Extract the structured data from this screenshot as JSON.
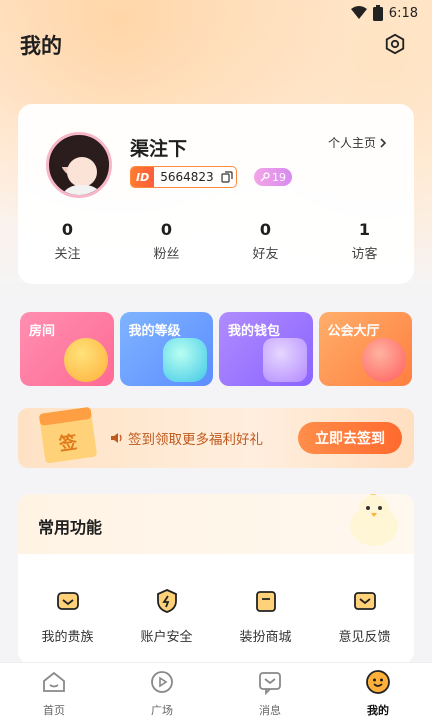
{
  "status_bar": {
    "time": "6:18"
  },
  "header": {
    "title": "我的"
  },
  "profile": {
    "username": "渠注下",
    "homepage_link": "个人主页",
    "id_tag": "ID",
    "id_value": "5664823",
    "level": "19",
    "stats": [
      {
        "value": "0",
        "label": "关注"
      },
      {
        "value": "0",
        "label": "粉丝"
      },
      {
        "value": "0",
        "label": "好友"
      },
      {
        "value": "1",
        "label": "访客"
      }
    ]
  },
  "features": [
    {
      "label": "房间"
    },
    {
      "label": "我的等级"
    },
    {
      "label": "我的钱包"
    },
    {
      "label": "公会大厅"
    }
  ],
  "signin": {
    "calendar_char": "签",
    "text": "签到领取更多福利好礼",
    "button": "立即去签到"
  },
  "tools": {
    "title": "常用功能",
    "items": [
      {
        "label": "我的贵族",
        "icon": "noble-icon"
      },
      {
        "label": "账户安全",
        "icon": "security-icon"
      },
      {
        "label": "装扮商城",
        "icon": "store-icon"
      },
      {
        "label": "意见反馈",
        "icon": "feedback-icon"
      }
    ]
  },
  "tabbar": {
    "items": [
      {
        "label": "首页",
        "icon": "home-icon"
      },
      {
        "label": "广场",
        "icon": "plaza-icon"
      },
      {
        "label": "消息",
        "icon": "message-icon"
      },
      {
        "label": "我的",
        "icon": "profile-icon"
      }
    ],
    "active_index": 3
  },
  "colors": {
    "accent": "#ff6a2e",
    "id_border": "#ff8a3d",
    "level_badge": "#d88af0"
  }
}
